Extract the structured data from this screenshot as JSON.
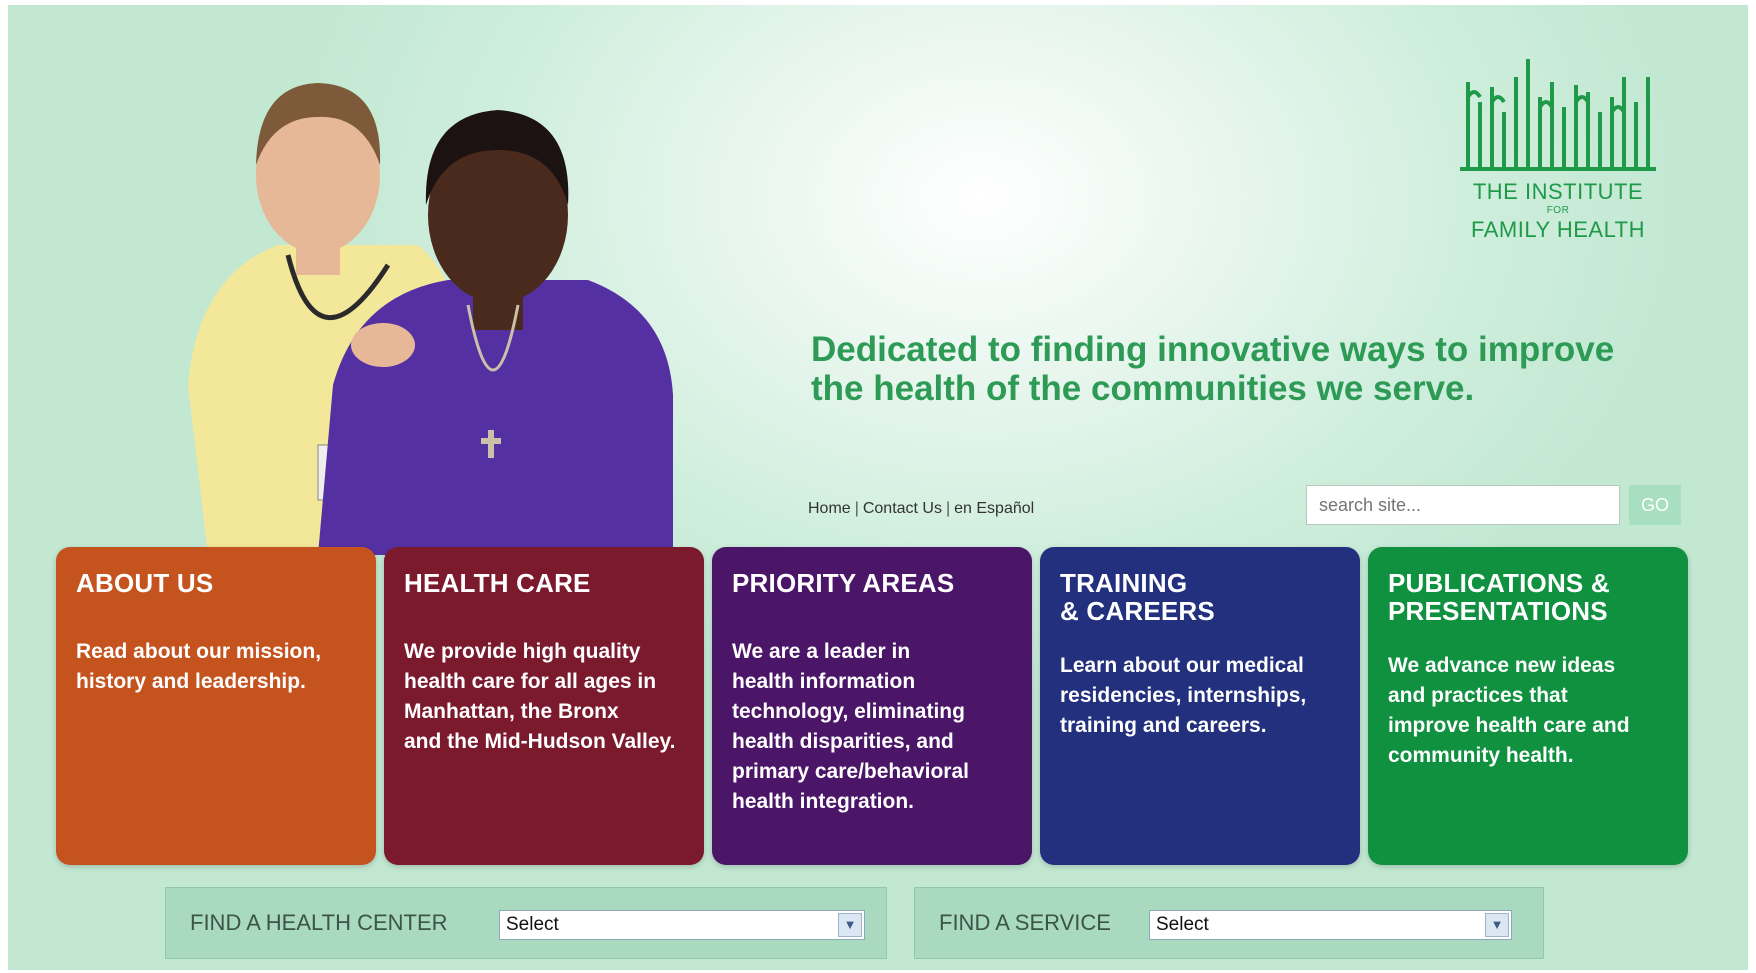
{
  "header": {
    "logo": {
      "line1": "THE INSTITUTE",
      "line2": "FOR",
      "line3": "FAMILY HEALTH",
      "color": "#1f9a49"
    },
    "tagline": "Dedicated to finding innovative ways to improve the health of the communities we serve."
  },
  "nav": {
    "home": "Home",
    "contact": "Contact Us",
    "spanish": "en Español",
    "separator": "|"
  },
  "search": {
    "placeholder": "search site...",
    "button": "GO"
  },
  "tiles": [
    {
      "title": "ABOUT US",
      "desc": "Read about our mission,\nhistory and leadership.",
      "color": "#c4531e"
    },
    {
      "title": "HEALTH CARE",
      "desc": "We provide high quality\nhealth care for all ages in\nManhattan, the Bronx\nand the Mid-Hudson Valley.",
      "color": "#7b1a2c"
    },
    {
      "title": "PRIORITY AREAS",
      "desc": "We are a leader in\nhealth information\ntechnology, eliminating\nhealth disparities, and\nprimary care/behavioral\nhealth integration.",
      "color": "#4b1668"
    },
    {
      "title": "TRAINING\n& CAREERS",
      "desc": "Learn about our medical\nresidencies, internships,\ntraining and careers.",
      "color": "#22307e"
    },
    {
      "title": "PUBLICATIONS &\nPRESENTATIONS",
      "desc": "We advance new ideas\nand practices that\nimprove health care and\ncommunity health.",
      "color": "#0f9140"
    }
  ],
  "finders": [
    {
      "label": "FIND A HEALTH CENTER",
      "selected": "Select"
    },
    {
      "label": "FIND A SERVICE",
      "selected": "Select"
    }
  ]
}
